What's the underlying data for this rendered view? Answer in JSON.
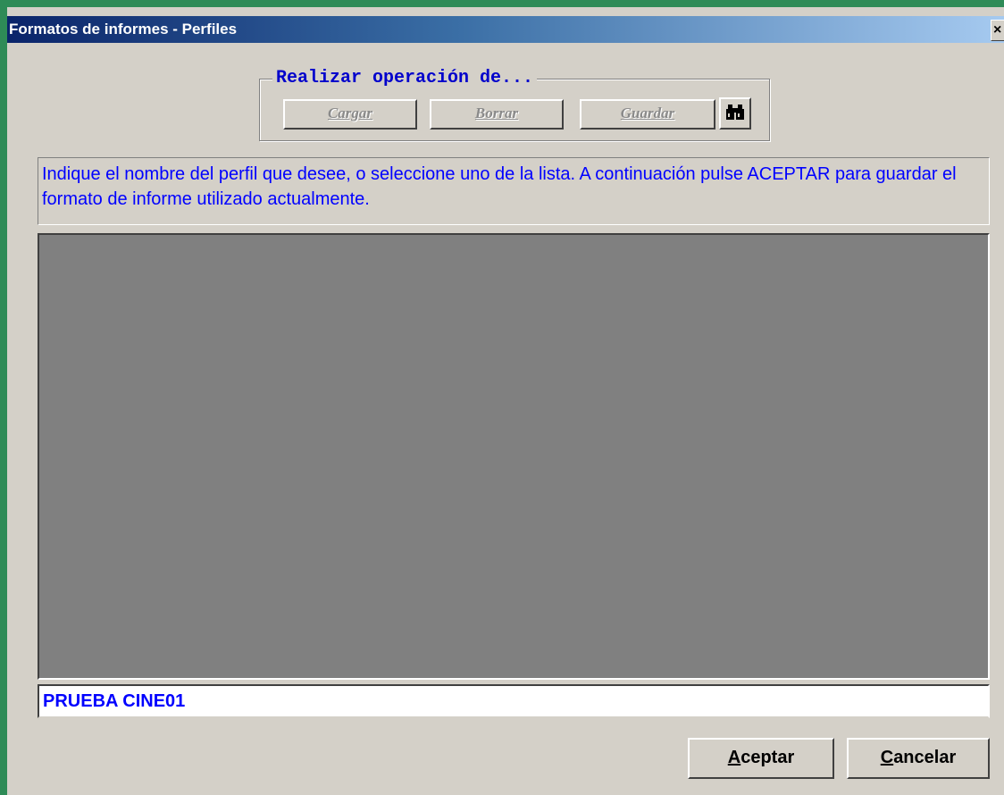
{
  "window": {
    "title": "Formatos de informes - Perfiles",
    "close_label": "×"
  },
  "operation": {
    "legend": "Realizar operación de...",
    "load_label": "Cargar",
    "delete_label": "Borrar",
    "save_label": "Guardar",
    "search_icon": "binoculars-icon"
  },
  "hint": {
    "text": "Indique el nombre del perfil que desee, o seleccione uno de la lista. A continuación pulse ACEPTAR para guardar el formato de informe utilizado actualmente."
  },
  "profiles": {
    "items": []
  },
  "profile_name": {
    "value": "PRUEBA CINE01"
  },
  "actions": {
    "accept_mnemonic": "A",
    "accept_rest": "ceptar",
    "cancel_mnemonic": "C",
    "cancel_rest": "ancelar"
  },
  "colors": {
    "desktop": "#2e8b57",
    "window_bg": "#d4d0c8",
    "title_start": "#0a246a",
    "accent_text": "#0000ff",
    "list_bg": "#808080"
  }
}
